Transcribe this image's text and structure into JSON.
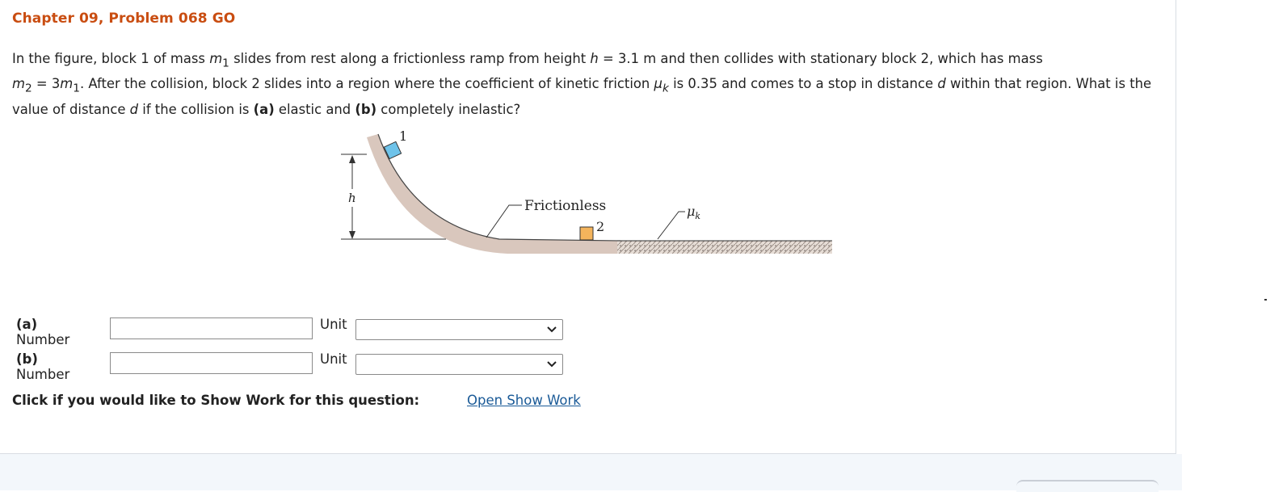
{
  "problem": {
    "title": "Chapter 09, Problem 068 GO",
    "text": {
      "p1": "In the figure, block 1 of mass ",
      "m": "m",
      "sub1": "1",
      "p2": " slides from rest along a frictionless ramp from height ",
      "h": "h",
      "p3": " = 3.1 m and then collides with stationary block 2, which has mass ",
      "m2": "m",
      "sub2": "2",
      "p4": " = 3",
      "m3": "m",
      "sub3": "1",
      "p5": ". After the collision, block 2 slides into a region where the coefficient of kinetic friction ",
      "mu": "μ",
      "subk": "k",
      "p6": " is 0.35 and comes to a stop in distance ",
      "d1": "d",
      "p7": " within that region. What is the value of distance ",
      "d2": "d",
      "p8": " if the collision is ",
      "a": "(a)",
      "p9": " elastic and ",
      "b": "(b)",
      "p10": " completely inelastic?"
    }
  },
  "figure": {
    "label_block1": "1",
    "label_h": "h",
    "label_frictionless": "Frictionless",
    "label_block2": "2",
    "label_mu": "μ",
    "label_mu_sub": "k",
    "colors": {
      "ramp": "#d9c7bd",
      "block1": "#6ec3ea",
      "block2": "#f4b45c",
      "rough": "#b8a9a0"
    }
  },
  "answers": [
    {
      "part": "(a)",
      "label": "Number",
      "value": "",
      "unit_label": "Unit",
      "unit_selected": ""
    },
    {
      "part": "(b)",
      "label": "Number",
      "value": "",
      "unit_label": "Unit",
      "unit_selected": ""
    }
  ],
  "show_work": {
    "prompt": "Click if you would like to Show Work for this question:",
    "link": "Open Show Work"
  }
}
